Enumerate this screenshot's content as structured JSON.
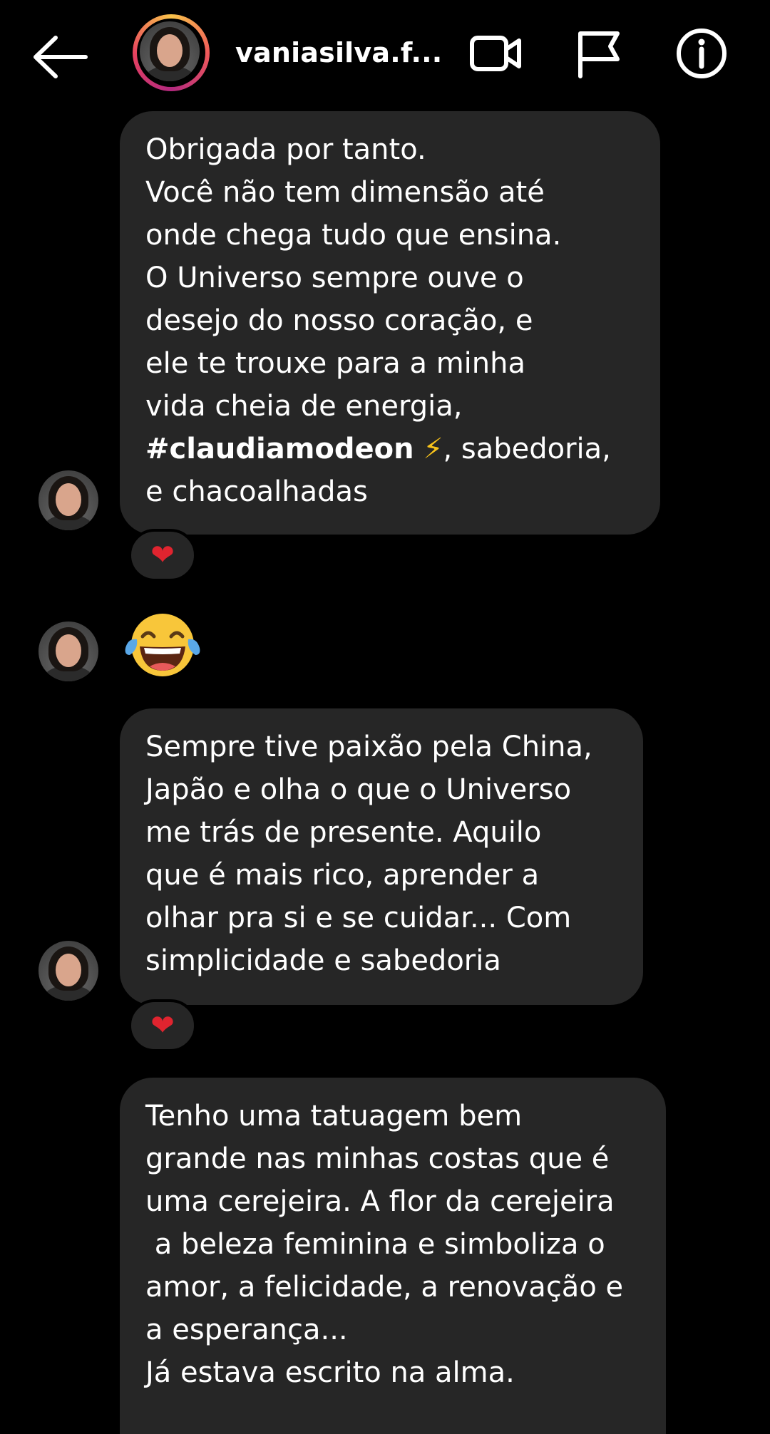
{
  "header": {
    "username": "vaniasilva.f...",
    "icons": [
      "back-arrow-icon",
      "video-call-icon",
      "report-flag-icon",
      "info-icon"
    ]
  },
  "messages": [
    {
      "lines": [
        "Obrigada por tanto.",
        "Você não tem dimensão até",
        "onde chega tudo que ensina.",
        "O Universo sempre ouve o",
        "desejo do nosso coração, e",
        "ele te trouxe para a minha",
        "vida cheia de energia,"
      ],
      "tag": "#claudiamodeon",
      "tag_emoji": "⚡",
      "tag_rest": ", sabedoria,",
      "last_line": "e chacoalhadas",
      "reaction": "❤"
    },
    {
      "emoji_name": "face-with-tears-of-joy"
    },
    {
      "lines": [
        "Sempre tive paixão pela China,",
        "Japão e olha o que o Universo",
        "me trás de presente. Aquilo",
        "que é mais rico, aprender a",
        "olhar pra si e se cuidar... Com",
        "simplicidade e sabedoria"
      ],
      "reaction": "❤"
    },
    {
      "lines": [
        "Tenho uma tatuagem bem",
        "grande nas minhas costas que é",
        "uma cerejeira. A flor da cerejeira",
        " a beleza feminina e simboliza o",
        "amor, a felicidade, a renovação e",
        "a esperança...",
        "Já estava escrito na alma."
      ]
    }
  ],
  "colors": {
    "bubble": "#262626",
    "background": "#000000",
    "heart": "#e0242f"
  }
}
